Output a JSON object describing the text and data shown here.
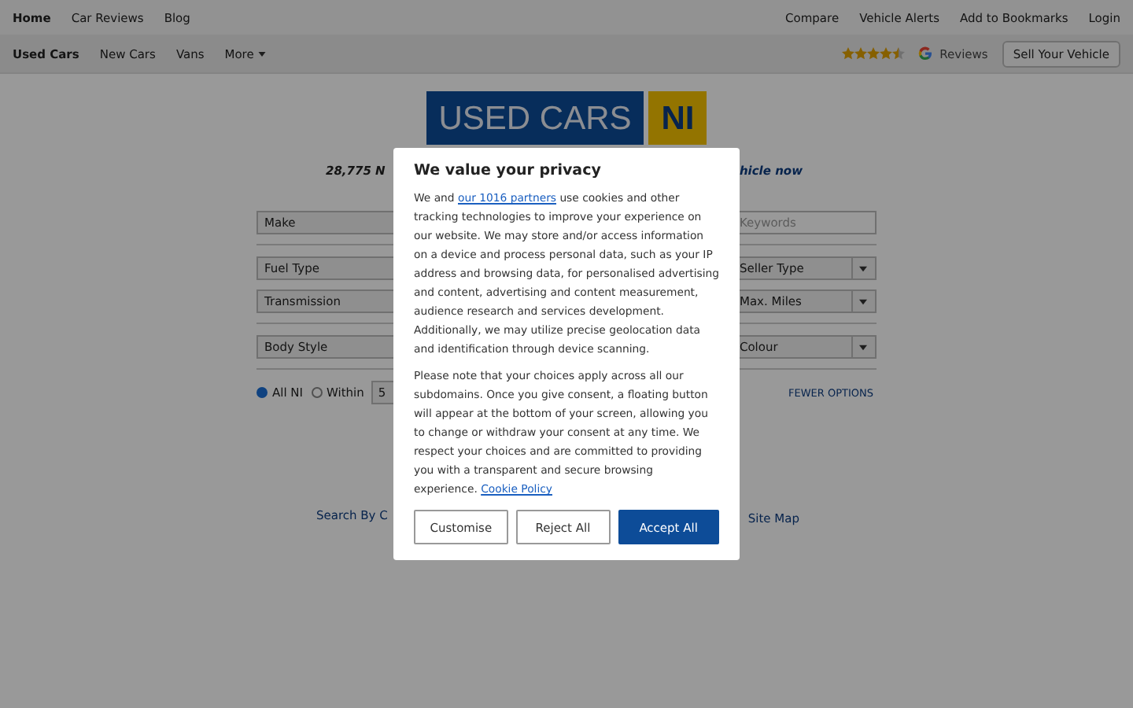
{
  "top_nav": {
    "left": [
      {
        "label": "Home",
        "selected": true
      },
      {
        "label": "Car Reviews",
        "selected": false
      },
      {
        "label": "Blog",
        "selected": false
      }
    ],
    "right": [
      "Compare",
      "Vehicle Alerts",
      "Add to Bookmarks",
      "Login"
    ]
  },
  "sub_nav": {
    "items": [
      {
        "label": "Used Cars",
        "selected": true,
        "dropdown": false
      },
      {
        "label": "New Cars",
        "selected": false,
        "dropdown": false
      },
      {
        "label": "Vans",
        "selected": false,
        "dropdown": false
      },
      {
        "label": "More",
        "selected": false,
        "dropdown": true
      }
    ],
    "rating": {
      "stars": 4.5,
      "label": "Reviews"
    },
    "sell_button": "Sell Your Vehicle"
  },
  "logo": {
    "main": "USED CARS",
    "region": "NI"
  },
  "count_text": "28,775 N",
  "cta_text": "hicle now",
  "search_form": {
    "groups": [
      [
        {
          "left": "Make",
          "right": {
            "kind": "field",
            "placeholder": "Keywords"
          }
        }
      ],
      [
        {
          "left": "Fuel Type",
          "right": {
            "kind": "select",
            "label": "Seller Type"
          }
        },
        {
          "left": "Transmission",
          "right": {
            "kind": "select",
            "label": "Max. Miles"
          }
        }
      ],
      [
        {
          "left": "Body Style",
          "right": {
            "kind": "select",
            "label": "Colour"
          }
        }
      ]
    ],
    "location": {
      "options": [
        {
          "label": "All NI",
          "selected": true
        },
        {
          "label": "Within",
          "selected": false
        }
      ],
      "distance": "5"
    },
    "fewer_options": "FEWER OPTIONS"
  },
  "footer_links": [
    "Search By C",
    "Site Map"
  ],
  "consent": {
    "title": "We value your privacy",
    "paragraph_1": {
      "before": "We and ",
      "link": "our 1016 partners",
      "after": " use cookies and other tracking technologies to improve your experience on our website. We may store and/or access information on a device and process personal data, such as your IP address and browsing data, for personalised advertising and content, advertising and content measurement, audience research and services development. Additionally, we may utilize precise geolocation data and identification through device scanning."
    },
    "paragraph_2": {
      "text": "Please note that your choices apply across all our subdomains. Once you give consent, a floating button will appear at the bottom of your screen, allowing you to change or withdraw your consent at any time. We respect your choices and are committed to providing you with a transparent and secure browsing experience. ",
      "link": "Cookie Policy"
    },
    "buttons": [
      {
        "label": "Customise",
        "kind": "secondary"
      },
      {
        "label": "Reject All",
        "kind": "secondary"
      },
      {
        "label": "Accept All",
        "kind": "primary"
      }
    ]
  }
}
